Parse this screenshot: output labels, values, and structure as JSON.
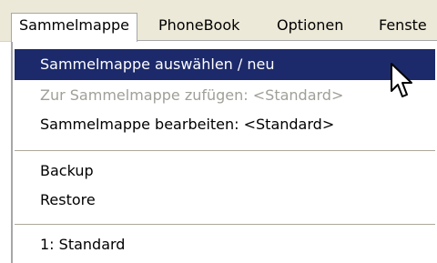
{
  "menubar": {
    "items": [
      {
        "label": "Sammelmappe"
      },
      {
        "label": "PhoneBook"
      },
      {
        "label": "Optionen"
      },
      {
        "label": "Fenste"
      }
    ]
  },
  "dropdown": {
    "items": [
      {
        "label": "Sammelmappe auswählen / neu",
        "state": "highlighted"
      },
      {
        "label": "Zur Sammelmappe zufügen: <Standard>",
        "state": "disabled"
      },
      {
        "label": "Sammelmappe bearbeiten: <Standard>",
        "state": "normal"
      },
      {
        "label": "Backup",
        "state": "normal"
      },
      {
        "label": "Restore",
        "state": "normal"
      },
      {
        "label": "1: Standard",
        "state": "normal"
      }
    ]
  },
  "cursor": {
    "icon": "arrow-pointer-icon"
  },
  "colors": {
    "highlight": "#1c2a6b",
    "menubar_bg": "#ece9d8",
    "disabled_text": "#a09f98"
  }
}
